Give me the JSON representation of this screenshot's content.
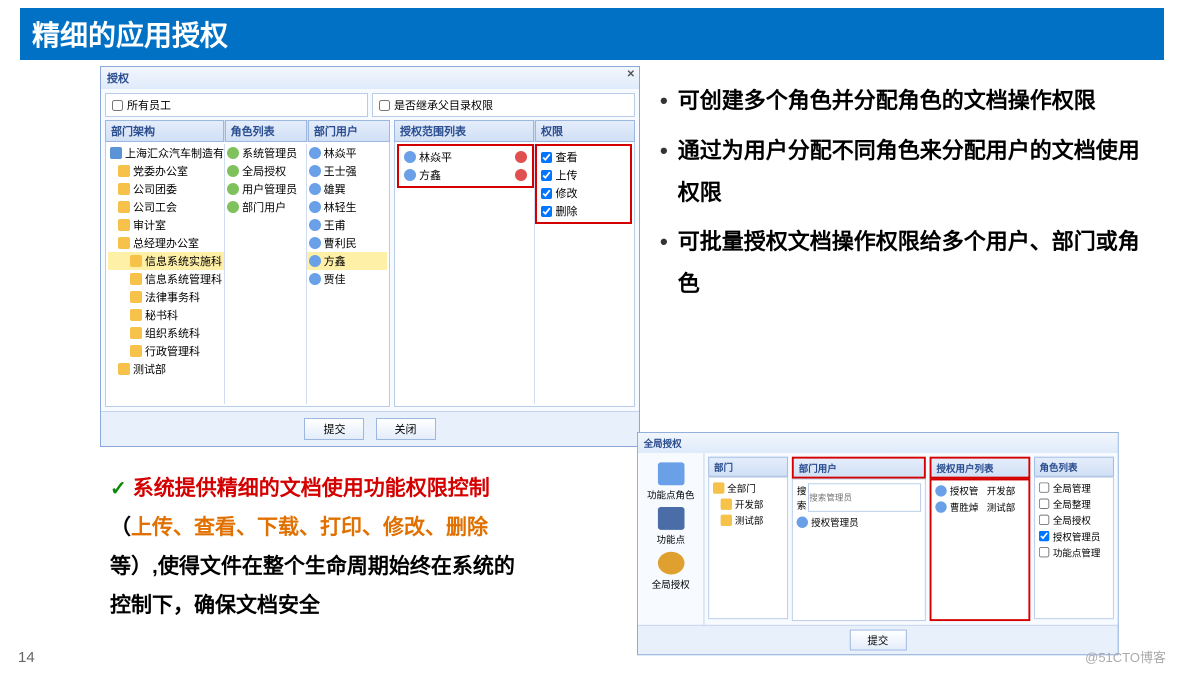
{
  "title": "精细的应用授权",
  "dialog": {
    "title": "授权",
    "all_staff": "所有员工",
    "inherit_perm": "是否继承父目录权限",
    "col_dept": "部门架构",
    "col_role": "角色列表",
    "col_dept_user": "部门用户",
    "col_perm_list": "授权范围列表",
    "col_perm": "权限",
    "tree": {
      "root": "上海汇众汽车制造有限公司",
      "n1": "党委办公室",
      "n2": "公司团委",
      "n3": "公司工会",
      "n4": "审计室",
      "n5": "总经理办公室",
      "n5a": "信息系统实施科",
      "n5b": "信息系统管理科",
      "n5c": "法律事务科",
      "n5d": "秘书科",
      "n5e": "组织系统科",
      "n5f": "行政管理科",
      "n6": "测试部"
    },
    "roles": {
      "r1": "系统管理员",
      "r2": "全局授权",
      "r3": "用户管理员",
      "r4": "部门用户"
    },
    "users": {
      "u1": "林焱平",
      "u2": "王士强",
      "u3": "雄巽",
      "u4": "林轻生",
      "u5": "王甫",
      "u6": "曹利民",
      "u7": "方鑫",
      "u8": "贾佳"
    },
    "perm_users": {
      "p1": "林焱平",
      "p2": "方鑫"
    },
    "perms": {
      "view": "查看",
      "upload": "上传",
      "modify": "修改",
      "delete": "删除"
    },
    "btn_submit": "提交",
    "btn_close": "关闭"
  },
  "bullets": {
    "b1": "可创建多个角色并分配角色的文档操作权限",
    "b2": "通过为用户分配不同角色来分配用户的文档使用权限",
    "b3": "可批量授权文档操作权限给多个用户、部门或角色"
  },
  "summary": {
    "s1a": "系统提供精细的文档使用功能权限控制",
    "s1b": "（",
    "s1c": "上传、查看、下载、打印、修改、删除",
    "s1d": "等）,使得文件在整个生命周期始终在系统的控制下，确保文档安全"
  },
  "dialog2": {
    "title": "全局授权",
    "side1": "功能点角色",
    "side2": "功能点",
    "side3": "全局授权",
    "col1": "部门",
    "col2": "部门用户",
    "col3": "授权用户列表",
    "col4": "角色列表",
    "dept1": "全部门",
    "dept1a": "开发部",
    "dept1b": "测试部",
    "search": "搜索",
    "search_ph": "搜索管理员",
    "u1": "授权管理员",
    "u2n": "授权管",
    "u2d": "开发部",
    "u3n": "曹胜焯",
    "u3d": "测试部",
    "r1": "全局管理",
    "r2": "全局整理",
    "r3": "全局授权",
    "r4": "授权管理员",
    "r5": "功能点管理",
    "btn": "提交"
  },
  "page_num": "14",
  "watermark": "@51CTO博客"
}
